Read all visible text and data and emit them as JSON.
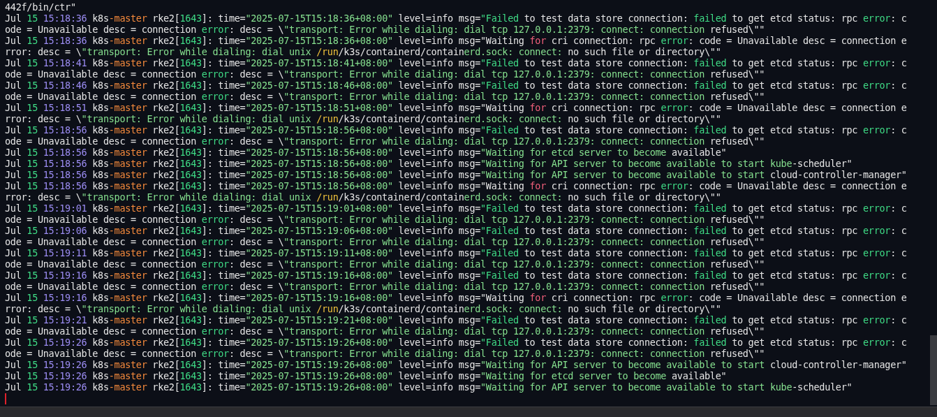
{
  "terminal": {
    "lines": [
      {
        "segments": [
          {
            "text": "442f/bin/ctr\"",
            "color": "#e6e6e6"
          }
        ]
      },
      {
        "segments": [
          {
            "text": "Jul ",
            "color": "#e6e6e6"
          },
          {
            "text": "15",
            "color": "#3fdc86"
          },
          {
            "text": " 15:18:36",
            "color": "#9b8cf2"
          },
          {
            "text": " k8s",
            "color": "#e6e6e6"
          },
          {
            "text": "-master",
            "color": "#f58a3c"
          },
          {
            "text": " rke2[",
            "color": "#e6e6e6"
          },
          {
            "text": "1643",
            "color": "#3fdc86"
          },
          {
            "text": "]: time=",
            "color": "#e6e6e6"
          },
          {
            "text": "\"2025-07-15T15:18:36+08:00\"",
            "color": "#86e08f"
          },
          {
            "text": " level=info msg=",
            "color": "#e6e6e6"
          },
          {
            "text": "\"Failed",
            "color": "#3fdc86"
          },
          {
            "text": " to test data store connection: ",
            "color": "#e6e6e6"
          },
          {
            "text": "failed",
            "color": "#3fdc86"
          },
          {
            "text": " to get etcd status: rpc ",
            "color": "#e6e6e6"
          },
          {
            "text": "error",
            "color": "#3fdc86"
          },
          {
            "text": ": c",
            "color": "#e6e6e6"
          }
        ]
      },
      {
        "segments": [
          {
            "text": "ode = Unavailable desc = connection ",
            "color": "#e6e6e6"
          },
          {
            "text": "error",
            "color": "#3fdc86"
          },
          {
            "text": ": desc = \\",
            "color": "#e6e6e6"
          },
          {
            "text": "\"transport: Error while dialing: dial tcp 127.0.0.1:2379: connect: connection",
            "color": "#86e08f"
          },
          {
            "text": " refused\\\"\"",
            "color": "#e6e6e6"
          }
        ]
      },
      {
        "segments": [
          {
            "text": "Jul ",
            "color": "#e6e6e6"
          },
          {
            "text": "15",
            "color": "#3fdc86"
          },
          {
            "text": " 15:18:36",
            "color": "#9b8cf2"
          },
          {
            "text": " k8s",
            "color": "#e6e6e6"
          },
          {
            "text": "-master",
            "color": "#f58a3c"
          },
          {
            "text": " rke2[",
            "color": "#e6e6e6"
          },
          {
            "text": "1643",
            "color": "#3fdc86"
          },
          {
            "text": "]: time=",
            "color": "#e6e6e6"
          },
          {
            "text": "\"2025-07-15T15:18:36+08:00\"",
            "color": "#86e08f"
          },
          {
            "text": " level=info msg=",
            "color": "#e6e6e6"
          },
          {
            "text": "\"Waiting ",
            "color": "#e6e6e6"
          },
          {
            "text": "for",
            "color": "#f2607b"
          },
          {
            "text": " cri connection: rpc ",
            "color": "#e6e6e6"
          },
          {
            "text": "error",
            "color": "#3fdc86"
          },
          {
            "text": ": code = Unavailable desc = connection e",
            "color": "#e6e6e6"
          }
        ]
      },
      {
        "segments": [
          {
            "text": "rror: desc = \\",
            "color": "#e6e6e6"
          },
          {
            "text": "\"transport: Error while dialing: dial unix ",
            "color": "#86e08f"
          },
          {
            "text": "/run",
            "color": "#f0c23c"
          },
          {
            "text": "/k3s/containerd/contain",
            "color": "#e6e6e6"
          },
          {
            "text": "erd.sock: connect:",
            "color": "#86e08f"
          },
          {
            "text": " no such file or directory\\\"\"",
            "color": "#e6e6e6"
          }
        ]
      },
      {
        "segments": [
          {
            "text": "Jul ",
            "color": "#e6e6e6"
          },
          {
            "text": "15",
            "color": "#3fdc86"
          },
          {
            "text": " 15:18:41",
            "color": "#9b8cf2"
          },
          {
            "text": " k8s",
            "color": "#e6e6e6"
          },
          {
            "text": "-master",
            "color": "#f58a3c"
          },
          {
            "text": " rke2[",
            "color": "#e6e6e6"
          },
          {
            "text": "1643",
            "color": "#3fdc86"
          },
          {
            "text": "]: time=",
            "color": "#e6e6e6"
          },
          {
            "text": "\"2025-07-15T15:18:41+08:00\"",
            "color": "#86e08f"
          },
          {
            "text": " level=info msg=",
            "color": "#e6e6e6"
          },
          {
            "text": "\"Failed",
            "color": "#3fdc86"
          },
          {
            "text": " to test data store connection: ",
            "color": "#e6e6e6"
          },
          {
            "text": "failed",
            "color": "#3fdc86"
          },
          {
            "text": " to get etcd status: rpc ",
            "color": "#e6e6e6"
          },
          {
            "text": "error",
            "color": "#3fdc86"
          },
          {
            "text": ": c",
            "color": "#e6e6e6"
          }
        ]
      },
      {
        "segments": [
          {
            "text": "ode = Unavailable desc = connection ",
            "color": "#e6e6e6"
          },
          {
            "text": "error",
            "color": "#3fdc86"
          },
          {
            "text": ": desc = \\",
            "color": "#e6e6e6"
          },
          {
            "text": "\"transport: Error while dialing: dial tcp 127.0.0.1:2379: connect: connection",
            "color": "#86e08f"
          },
          {
            "text": " refused\\\"\"",
            "color": "#e6e6e6"
          }
        ]
      },
      {
        "segments": [
          {
            "text": "Jul ",
            "color": "#e6e6e6"
          },
          {
            "text": "15",
            "color": "#3fdc86"
          },
          {
            "text": " 15:18:46",
            "color": "#9b8cf2"
          },
          {
            "text": " k8s",
            "color": "#e6e6e6"
          },
          {
            "text": "-master",
            "color": "#f58a3c"
          },
          {
            "text": " rke2[",
            "color": "#e6e6e6"
          },
          {
            "text": "1643",
            "color": "#3fdc86"
          },
          {
            "text": "]: time=",
            "color": "#e6e6e6"
          },
          {
            "text": "\"2025-07-15T15:18:46+08:00\"",
            "color": "#86e08f"
          },
          {
            "text": " level=info msg=",
            "color": "#e6e6e6"
          },
          {
            "text": "\"Failed",
            "color": "#3fdc86"
          },
          {
            "text": " to test data store connection: ",
            "color": "#e6e6e6"
          },
          {
            "text": "failed",
            "color": "#3fdc86"
          },
          {
            "text": " to get etcd status: rpc ",
            "color": "#e6e6e6"
          },
          {
            "text": "error",
            "color": "#3fdc86"
          },
          {
            "text": ": c",
            "color": "#e6e6e6"
          }
        ]
      },
      {
        "segments": [
          {
            "text": "ode = Unavailable desc = connection ",
            "color": "#e6e6e6"
          },
          {
            "text": "error",
            "color": "#3fdc86"
          },
          {
            "text": ": desc = \\",
            "color": "#e6e6e6"
          },
          {
            "text": "\"transport: Error while dialing: dial tcp 127.0.0.1:2379: connect: connection",
            "color": "#86e08f"
          },
          {
            "text": " refused\\\"\"",
            "color": "#e6e6e6"
          }
        ]
      },
      {
        "segments": [
          {
            "text": "Jul ",
            "color": "#e6e6e6"
          },
          {
            "text": "15",
            "color": "#3fdc86"
          },
          {
            "text": " 15:18:51",
            "color": "#9b8cf2"
          },
          {
            "text": " k8s",
            "color": "#e6e6e6"
          },
          {
            "text": "-master",
            "color": "#f58a3c"
          },
          {
            "text": " rke2[",
            "color": "#e6e6e6"
          },
          {
            "text": "1643",
            "color": "#3fdc86"
          },
          {
            "text": "]: time=",
            "color": "#e6e6e6"
          },
          {
            "text": "\"2025-07-15T15:18:51+08:00\"",
            "color": "#86e08f"
          },
          {
            "text": " level=info msg=",
            "color": "#e6e6e6"
          },
          {
            "text": "\"Waiting ",
            "color": "#e6e6e6"
          },
          {
            "text": "for",
            "color": "#f2607b"
          },
          {
            "text": " cri connection: rpc ",
            "color": "#e6e6e6"
          },
          {
            "text": "error",
            "color": "#3fdc86"
          },
          {
            "text": ": code = Unavailable desc = connection e",
            "color": "#e6e6e6"
          }
        ]
      },
      {
        "segments": [
          {
            "text": "rror: desc = \\",
            "color": "#e6e6e6"
          },
          {
            "text": "\"transport: Error while dialing: dial unix ",
            "color": "#86e08f"
          },
          {
            "text": "/run",
            "color": "#f0c23c"
          },
          {
            "text": "/k3s/containerd/contain",
            "color": "#e6e6e6"
          },
          {
            "text": "erd.sock: connect:",
            "color": "#86e08f"
          },
          {
            "text": " no such file or directory\\\"\"",
            "color": "#e6e6e6"
          }
        ]
      },
      {
        "segments": [
          {
            "text": "Jul ",
            "color": "#e6e6e6"
          },
          {
            "text": "15",
            "color": "#3fdc86"
          },
          {
            "text": " 15:18:56",
            "color": "#9b8cf2"
          },
          {
            "text": " k8s",
            "color": "#e6e6e6"
          },
          {
            "text": "-master",
            "color": "#f58a3c"
          },
          {
            "text": " rke2[",
            "color": "#e6e6e6"
          },
          {
            "text": "1643",
            "color": "#3fdc86"
          },
          {
            "text": "]: time=",
            "color": "#e6e6e6"
          },
          {
            "text": "\"2025-07-15T15:18:56+08:00\"",
            "color": "#86e08f"
          },
          {
            "text": " level=info msg=",
            "color": "#e6e6e6"
          },
          {
            "text": "\"Failed",
            "color": "#3fdc86"
          },
          {
            "text": " to test data store connection: ",
            "color": "#e6e6e6"
          },
          {
            "text": "failed",
            "color": "#3fdc86"
          },
          {
            "text": " to get etcd status: rpc ",
            "color": "#e6e6e6"
          },
          {
            "text": "error",
            "color": "#3fdc86"
          },
          {
            "text": ": c",
            "color": "#e6e6e6"
          }
        ]
      },
      {
        "segments": [
          {
            "text": "ode = Unavailable desc = connection ",
            "color": "#e6e6e6"
          },
          {
            "text": "error",
            "color": "#3fdc86"
          },
          {
            "text": ": desc = \\",
            "color": "#e6e6e6"
          },
          {
            "text": "\"transport: Error while dialing: dial tcp 127.0.0.1:2379: connect: connection",
            "color": "#86e08f"
          },
          {
            "text": " refused\\\"\"",
            "color": "#e6e6e6"
          }
        ]
      },
      {
        "segments": [
          {
            "text": "Jul ",
            "color": "#e6e6e6"
          },
          {
            "text": "15",
            "color": "#3fdc86"
          },
          {
            "text": " 15:18:56",
            "color": "#9b8cf2"
          },
          {
            "text": " k8s",
            "color": "#e6e6e6"
          },
          {
            "text": "-master",
            "color": "#f58a3c"
          },
          {
            "text": " rke2[",
            "color": "#e6e6e6"
          },
          {
            "text": "1643",
            "color": "#3fdc86"
          },
          {
            "text": "]: time=",
            "color": "#e6e6e6"
          },
          {
            "text": "\"2025-07-15T15:18:56+08:00\"",
            "color": "#86e08f"
          },
          {
            "text": " level=info msg=",
            "color": "#e6e6e6"
          },
          {
            "text": "\"Waiting for etcd server to become ",
            "color": "#86e08f"
          },
          {
            "text": "available\"",
            "color": "#e6e6e6"
          }
        ]
      },
      {
        "segments": [
          {
            "text": "Jul ",
            "color": "#e6e6e6"
          },
          {
            "text": "15",
            "color": "#3fdc86"
          },
          {
            "text": " 15:18:56",
            "color": "#9b8cf2"
          },
          {
            "text": " k8s",
            "color": "#e6e6e6"
          },
          {
            "text": "-master",
            "color": "#f58a3c"
          },
          {
            "text": " rke2[",
            "color": "#e6e6e6"
          },
          {
            "text": "1643",
            "color": "#3fdc86"
          },
          {
            "text": "]: time=",
            "color": "#e6e6e6"
          },
          {
            "text": "\"2025-07-15T15:18:56+08:00\"",
            "color": "#86e08f"
          },
          {
            "text": " level=info msg=",
            "color": "#e6e6e6"
          },
          {
            "text": "\"Waiting for API server to become available to start kube",
            "color": "#86e08f"
          },
          {
            "text": "-scheduler\"",
            "color": "#e6e6e6"
          }
        ]
      },
      {
        "segments": [
          {
            "text": "Jul ",
            "color": "#e6e6e6"
          },
          {
            "text": "15",
            "color": "#3fdc86"
          },
          {
            "text": " 15:18:56",
            "color": "#9b8cf2"
          },
          {
            "text": " k8s",
            "color": "#e6e6e6"
          },
          {
            "text": "-master",
            "color": "#f58a3c"
          },
          {
            "text": " rke2[",
            "color": "#e6e6e6"
          },
          {
            "text": "1643",
            "color": "#3fdc86"
          },
          {
            "text": "]: time=",
            "color": "#e6e6e6"
          },
          {
            "text": "\"2025-07-15T15:18:56+08:00\"",
            "color": "#86e08f"
          },
          {
            "text": " level=info msg=",
            "color": "#e6e6e6"
          },
          {
            "text": "\"Waiting for API server to become available to start ",
            "color": "#86e08f"
          },
          {
            "text": "cloud-controller-manager\"",
            "color": "#e6e6e6"
          }
        ]
      },
      {
        "segments": [
          {
            "text": "Jul ",
            "color": "#e6e6e6"
          },
          {
            "text": "15",
            "color": "#3fdc86"
          },
          {
            "text": " 15:18:56",
            "color": "#9b8cf2"
          },
          {
            "text": " k8s",
            "color": "#e6e6e6"
          },
          {
            "text": "-master",
            "color": "#f58a3c"
          },
          {
            "text": " rke2[",
            "color": "#e6e6e6"
          },
          {
            "text": "1643",
            "color": "#3fdc86"
          },
          {
            "text": "]: time=",
            "color": "#e6e6e6"
          },
          {
            "text": "\"2025-07-15T15:18:56+08:00\"",
            "color": "#86e08f"
          },
          {
            "text": " level=info msg=",
            "color": "#e6e6e6"
          },
          {
            "text": "\"Waiting ",
            "color": "#e6e6e6"
          },
          {
            "text": "for",
            "color": "#f2607b"
          },
          {
            "text": " cri connection: rpc ",
            "color": "#e6e6e6"
          },
          {
            "text": "error",
            "color": "#3fdc86"
          },
          {
            "text": ": code = Unavailable desc = connection e",
            "color": "#e6e6e6"
          }
        ]
      },
      {
        "segments": [
          {
            "text": "rror: desc = \\",
            "color": "#e6e6e6"
          },
          {
            "text": "\"transport: Error while dialing: dial unix ",
            "color": "#86e08f"
          },
          {
            "text": "/run",
            "color": "#f0c23c"
          },
          {
            "text": "/k3s/containerd/contain",
            "color": "#e6e6e6"
          },
          {
            "text": "erd.sock: connect:",
            "color": "#86e08f"
          },
          {
            "text": " no such file or directory\\\"\"",
            "color": "#e6e6e6"
          }
        ]
      },
      {
        "segments": [
          {
            "text": "Jul ",
            "color": "#e6e6e6"
          },
          {
            "text": "15",
            "color": "#3fdc86"
          },
          {
            "text": " 15:19:01",
            "color": "#9b8cf2"
          },
          {
            "text": " k8s",
            "color": "#e6e6e6"
          },
          {
            "text": "-master",
            "color": "#f58a3c"
          },
          {
            "text": " rke2[",
            "color": "#e6e6e6"
          },
          {
            "text": "1643",
            "color": "#3fdc86"
          },
          {
            "text": "]: time=",
            "color": "#e6e6e6"
          },
          {
            "text": "\"2025-07-15T15:19:01+08:00\"",
            "color": "#86e08f"
          },
          {
            "text": " level=info msg=",
            "color": "#e6e6e6"
          },
          {
            "text": "\"Failed",
            "color": "#3fdc86"
          },
          {
            "text": " to test data store connection: ",
            "color": "#e6e6e6"
          },
          {
            "text": "failed",
            "color": "#3fdc86"
          },
          {
            "text": " to get etcd status: rpc ",
            "color": "#e6e6e6"
          },
          {
            "text": "error",
            "color": "#3fdc86"
          },
          {
            "text": ": c",
            "color": "#e6e6e6"
          }
        ]
      },
      {
        "segments": [
          {
            "text": "ode = Unavailable desc = connection ",
            "color": "#e6e6e6"
          },
          {
            "text": "error",
            "color": "#3fdc86"
          },
          {
            "text": ": desc = \\",
            "color": "#e6e6e6"
          },
          {
            "text": "\"transport: Error while dialing: dial tcp 127.0.0.1:2379: connect: connection",
            "color": "#86e08f"
          },
          {
            "text": " refused\\\"\"",
            "color": "#e6e6e6"
          }
        ]
      },
      {
        "segments": [
          {
            "text": "Jul ",
            "color": "#e6e6e6"
          },
          {
            "text": "15",
            "color": "#3fdc86"
          },
          {
            "text": " 15:19:06",
            "color": "#9b8cf2"
          },
          {
            "text": " k8s",
            "color": "#e6e6e6"
          },
          {
            "text": "-master",
            "color": "#f58a3c"
          },
          {
            "text": " rke2[",
            "color": "#e6e6e6"
          },
          {
            "text": "1643",
            "color": "#3fdc86"
          },
          {
            "text": "]: time=",
            "color": "#e6e6e6"
          },
          {
            "text": "\"2025-07-15T15:19:06+08:00\"",
            "color": "#86e08f"
          },
          {
            "text": " level=info msg=",
            "color": "#e6e6e6"
          },
          {
            "text": "\"Failed",
            "color": "#3fdc86"
          },
          {
            "text": " to test data store connection: ",
            "color": "#e6e6e6"
          },
          {
            "text": "failed",
            "color": "#3fdc86"
          },
          {
            "text": " to get etcd status: rpc ",
            "color": "#e6e6e6"
          },
          {
            "text": "error",
            "color": "#3fdc86"
          },
          {
            "text": ": c",
            "color": "#e6e6e6"
          }
        ]
      },
      {
        "segments": [
          {
            "text": "ode = Unavailable desc = connection ",
            "color": "#e6e6e6"
          },
          {
            "text": "error",
            "color": "#3fdc86"
          },
          {
            "text": ": desc = \\",
            "color": "#e6e6e6"
          },
          {
            "text": "\"transport: Error while dialing: dial tcp 127.0.0.1:2379: connect: connection",
            "color": "#86e08f"
          },
          {
            "text": " refused\\\"\"",
            "color": "#e6e6e6"
          }
        ]
      },
      {
        "segments": [
          {
            "text": "Jul ",
            "color": "#e6e6e6"
          },
          {
            "text": "15",
            "color": "#3fdc86"
          },
          {
            "text": " 15:19:11",
            "color": "#9b8cf2"
          },
          {
            "text": " k8s",
            "color": "#e6e6e6"
          },
          {
            "text": "-master",
            "color": "#f58a3c"
          },
          {
            "text": " rke2[",
            "color": "#e6e6e6"
          },
          {
            "text": "1643",
            "color": "#3fdc86"
          },
          {
            "text": "]: time=",
            "color": "#e6e6e6"
          },
          {
            "text": "\"2025-07-15T15:19:11+08:00\"",
            "color": "#86e08f"
          },
          {
            "text": " level=info msg=",
            "color": "#e6e6e6"
          },
          {
            "text": "\"Failed",
            "color": "#3fdc86"
          },
          {
            "text": " to test data store connection: ",
            "color": "#e6e6e6"
          },
          {
            "text": "failed",
            "color": "#3fdc86"
          },
          {
            "text": " to get etcd status: rpc ",
            "color": "#e6e6e6"
          },
          {
            "text": "error",
            "color": "#3fdc86"
          },
          {
            "text": ": c",
            "color": "#e6e6e6"
          }
        ]
      },
      {
        "segments": [
          {
            "text": "ode = Unavailable desc = connection ",
            "color": "#e6e6e6"
          },
          {
            "text": "error",
            "color": "#3fdc86"
          },
          {
            "text": ": desc = \\",
            "color": "#e6e6e6"
          },
          {
            "text": "\"transport: Error while dialing: dial tcp 127.0.0.1:2379: connect: connection",
            "color": "#86e08f"
          },
          {
            "text": " refused\\\"\"",
            "color": "#e6e6e6"
          }
        ]
      },
      {
        "segments": [
          {
            "text": "Jul ",
            "color": "#e6e6e6"
          },
          {
            "text": "15",
            "color": "#3fdc86"
          },
          {
            "text": " 15:19:16",
            "color": "#9b8cf2"
          },
          {
            "text": " k8s",
            "color": "#e6e6e6"
          },
          {
            "text": "-master",
            "color": "#f58a3c"
          },
          {
            "text": " rke2[",
            "color": "#e6e6e6"
          },
          {
            "text": "1643",
            "color": "#3fdc86"
          },
          {
            "text": "]: time=",
            "color": "#e6e6e6"
          },
          {
            "text": "\"2025-07-15T15:19:16+08:00\"",
            "color": "#86e08f"
          },
          {
            "text": " level=info msg=",
            "color": "#e6e6e6"
          },
          {
            "text": "\"Failed",
            "color": "#3fdc86"
          },
          {
            "text": " to test data store connection: ",
            "color": "#e6e6e6"
          },
          {
            "text": "failed",
            "color": "#3fdc86"
          },
          {
            "text": " to get etcd status: rpc ",
            "color": "#e6e6e6"
          },
          {
            "text": "error",
            "color": "#3fdc86"
          },
          {
            "text": ": c",
            "color": "#e6e6e6"
          }
        ]
      },
      {
        "segments": [
          {
            "text": "ode = Unavailable desc = connection ",
            "color": "#e6e6e6"
          },
          {
            "text": "error",
            "color": "#3fdc86"
          },
          {
            "text": ": desc = \\",
            "color": "#e6e6e6"
          },
          {
            "text": "\"transport: Error while dialing: dial tcp 127.0.0.1:2379: connect: connection",
            "color": "#86e08f"
          },
          {
            "text": " refused\\\"\"",
            "color": "#e6e6e6"
          }
        ]
      },
      {
        "segments": [
          {
            "text": "Jul ",
            "color": "#e6e6e6"
          },
          {
            "text": "15",
            "color": "#3fdc86"
          },
          {
            "text": " 15:19:16",
            "color": "#9b8cf2"
          },
          {
            "text": " k8s",
            "color": "#e6e6e6"
          },
          {
            "text": "-master",
            "color": "#f58a3c"
          },
          {
            "text": " rke2[",
            "color": "#e6e6e6"
          },
          {
            "text": "1643",
            "color": "#3fdc86"
          },
          {
            "text": "]: time=",
            "color": "#e6e6e6"
          },
          {
            "text": "\"2025-07-15T15:19:16+08:00\"",
            "color": "#86e08f"
          },
          {
            "text": " level=info msg=",
            "color": "#e6e6e6"
          },
          {
            "text": "\"Waiting ",
            "color": "#e6e6e6"
          },
          {
            "text": "for",
            "color": "#f2607b"
          },
          {
            "text": " cri connection: rpc ",
            "color": "#e6e6e6"
          },
          {
            "text": "error",
            "color": "#3fdc86"
          },
          {
            "text": ": code = Unavailable desc = connection e",
            "color": "#e6e6e6"
          }
        ]
      },
      {
        "segments": [
          {
            "text": "rror: desc = \\",
            "color": "#e6e6e6"
          },
          {
            "text": "\"transport: Error while dialing: dial unix ",
            "color": "#86e08f"
          },
          {
            "text": "/run",
            "color": "#f0c23c"
          },
          {
            "text": "/k3s/containerd/contain",
            "color": "#e6e6e6"
          },
          {
            "text": "erd.sock: connect:",
            "color": "#86e08f"
          },
          {
            "text": " no such file or directory\\\"\"",
            "color": "#e6e6e6"
          }
        ]
      },
      {
        "segments": [
          {
            "text": "Jul ",
            "color": "#e6e6e6"
          },
          {
            "text": "15",
            "color": "#3fdc86"
          },
          {
            "text": " 15:19:21",
            "color": "#9b8cf2"
          },
          {
            "text": " k8s",
            "color": "#e6e6e6"
          },
          {
            "text": "-master",
            "color": "#f58a3c"
          },
          {
            "text": " rke2[",
            "color": "#e6e6e6"
          },
          {
            "text": "1643",
            "color": "#3fdc86"
          },
          {
            "text": "]: time=",
            "color": "#e6e6e6"
          },
          {
            "text": "\"2025-07-15T15:19:21+08:00\"",
            "color": "#86e08f"
          },
          {
            "text": " level=info msg=",
            "color": "#e6e6e6"
          },
          {
            "text": "\"Failed",
            "color": "#3fdc86"
          },
          {
            "text": " to test data store connection: ",
            "color": "#e6e6e6"
          },
          {
            "text": "failed",
            "color": "#3fdc86"
          },
          {
            "text": " to get etcd status: rpc ",
            "color": "#e6e6e6"
          },
          {
            "text": "error",
            "color": "#3fdc86"
          },
          {
            "text": ": c",
            "color": "#e6e6e6"
          }
        ]
      },
      {
        "segments": [
          {
            "text": "ode = Unavailable desc = connection ",
            "color": "#e6e6e6"
          },
          {
            "text": "error",
            "color": "#3fdc86"
          },
          {
            "text": ": desc = \\",
            "color": "#e6e6e6"
          },
          {
            "text": "\"transport: Error while dialing: dial tcp 127.0.0.1:2379: connect: connection",
            "color": "#86e08f"
          },
          {
            "text": " refused\\\"\"",
            "color": "#e6e6e6"
          }
        ]
      },
      {
        "segments": [
          {
            "text": "Jul ",
            "color": "#e6e6e6"
          },
          {
            "text": "15",
            "color": "#3fdc86"
          },
          {
            "text": " 15:19:26",
            "color": "#9b8cf2"
          },
          {
            "text": " k8s",
            "color": "#e6e6e6"
          },
          {
            "text": "-master",
            "color": "#f58a3c"
          },
          {
            "text": " rke2[",
            "color": "#e6e6e6"
          },
          {
            "text": "1643",
            "color": "#3fdc86"
          },
          {
            "text": "]: time=",
            "color": "#e6e6e6"
          },
          {
            "text": "\"2025-07-15T15:19:26+08:00\"",
            "color": "#86e08f"
          },
          {
            "text": " level=info msg=",
            "color": "#e6e6e6"
          },
          {
            "text": "\"Failed",
            "color": "#3fdc86"
          },
          {
            "text": " to test data store connection: ",
            "color": "#e6e6e6"
          },
          {
            "text": "failed",
            "color": "#3fdc86"
          },
          {
            "text": " to get etcd status: rpc ",
            "color": "#e6e6e6"
          },
          {
            "text": "error",
            "color": "#3fdc86"
          },
          {
            "text": ": c",
            "color": "#e6e6e6"
          }
        ]
      },
      {
        "segments": [
          {
            "text": "ode = Unavailable desc = connection ",
            "color": "#e6e6e6"
          },
          {
            "text": "error",
            "color": "#3fdc86"
          },
          {
            "text": ": desc = \\",
            "color": "#e6e6e6"
          },
          {
            "text": "\"transport: Error while dialing: dial tcp 127.0.0.1:2379: connect: connection",
            "color": "#86e08f"
          },
          {
            "text": " refused\\\"\"",
            "color": "#e6e6e6"
          }
        ]
      },
      {
        "segments": [
          {
            "text": "Jul ",
            "color": "#e6e6e6"
          },
          {
            "text": "15",
            "color": "#3fdc86"
          },
          {
            "text": " 15:19:26",
            "color": "#9b8cf2"
          },
          {
            "text": " k8s",
            "color": "#e6e6e6"
          },
          {
            "text": "-master",
            "color": "#f58a3c"
          },
          {
            "text": " rke2[",
            "color": "#e6e6e6"
          },
          {
            "text": "1643",
            "color": "#3fdc86"
          },
          {
            "text": "]: time=",
            "color": "#e6e6e6"
          },
          {
            "text": "\"2025-07-15T15:19:26+08:00\"",
            "color": "#86e08f"
          },
          {
            "text": " level=info msg=",
            "color": "#e6e6e6"
          },
          {
            "text": "\"Waiting for API server to become available to start ",
            "color": "#86e08f"
          },
          {
            "text": "cloud-controller-manager\"",
            "color": "#e6e6e6"
          }
        ]
      },
      {
        "segments": [
          {
            "text": "Jul ",
            "color": "#e6e6e6"
          },
          {
            "text": "15",
            "color": "#3fdc86"
          },
          {
            "text": " 15:19:26",
            "color": "#9b8cf2"
          },
          {
            "text": " k8s",
            "color": "#e6e6e6"
          },
          {
            "text": "-master",
            "color": "#f58a3c"
          },
          {
            "text": " rke2[",
            "color": "#e6e6e6"
          },
          {
            "text": "1643",
            "color": "#3fdc86"
          },
          {
            "text": "]: time=",
            "color": "#e6e6e6"
          },
          {
            "text": "\"2025-07-15T15:19:26+08:00\"",
            "color": "#86e08f"
          },
          {
            "text": " level=info msg=",
            "color": "#e6e6e6"
          },
          {
            "text": "\"Waiting for etcd server to become ",
            "color": "#86e08f"
          },
          {
            "text": "available\"",
            "color": "#e6e6e6"
          }
        ]
      },
      {
        "segments": [
          {
            "text": "Jul ",
            "color": "#e6e6e6"
          },
          {
            "text": "15",
            "color": "#3fdc86"
          },
          {
            "text": " 15:19:26",
            "color": "#9b8cf2"
          },
          {
            "text": " k8s",
            "color": "#e6e6e6"
          },
          {
            "text": "-master",
            "color": "#f58a3c"
          },
          {
            "text": " rke2[",
            "color": "#e6e6e6"
          },
          {
            "text": "1643",
            "color": "#3fdc86"
          },
          {
            "text": "]: time=",
            "color": "#e6e6e6"
          },
          {
            "text": "\"2025-07-15T15:19:26+08:00\"",
            "color": "#86e08f"
          },
          {
            "text": " level=info msg=",
            "color": "#e6e6e6"
          },
          {
            "text": "\"Waiting for API server to become available to start kube",
            "color": "#86e08f"
          },
          {
            "text": "-scheduler\"",
            "color": "#e6e6e6"
          }
        ]
      }
    ]
  }
}
